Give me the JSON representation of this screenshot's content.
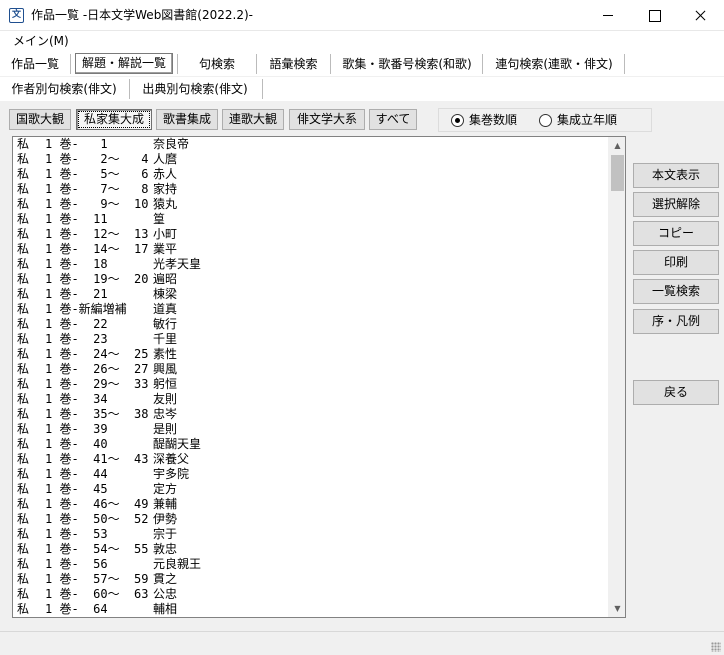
{
  "window": {
    "title": "作品一覧 -日本文学Web図書館(2022.2)-",
    "icon": "book-app-icon"
  },
  "menu": {
    "main": "メイン(M)"
  },
  "tabs_row1": [
    {
      "label": "作品一覧",
      "active": false
    },
    {
      "label": "解題・解説一覧",
      "active": true
    },
    {
      "label": "句検索",
      "active": false
    },
    {
      "label": "語彙検索",
      "active": false
    },
    {
      "label": "歌集・歌番号検索(和歌)",
      "active": false
    },
    {
      "label": "連句検索(連歌・俳文)",
      "active": false
    }
  ],
  "tabs_row2": [
    {
      "label": "作者別句検索(俳文)",
      "active": false
    },
    {
      "label": "出典別句検索(俳文)",
      "active": false
    }
  ],
  "category_buttons": [
    {
      "label": "国歌大観",
      "pressed": false
    },
    {
      "label": "私家集大成",
      "pressed": true
    },
    {
      "label": "歌書集成",
      "pressed": false
    },
    {
      "label": "連歌大観",
      "pressed": false
    },
    {
      "label": "俳文学大系",
      "pressed": false
    },
    {
      "label": "すべて",
      "pressed": false
    }
  ],
  "sort_options": [
    {
      "label": "集巻数順",
      "selected": true
    },
    {
      "label": "集成立年順",
      "selected": false
    }
  ],
  "list_rows": [
    [
      "私",
      "1 巻-   1",
      "奈良帝"
    ],
    [
      "私",
      "1 巻-   2～   4",
      "人麿"
    ],
    [
      "私",
      "1 巻-   5～   6",
      "赤人"
    ],
    [
      "私",
      "1 巻-   7～   8",
      "家持"
    ],
    [
      "私",
      "1 巻-   9～  10",
      "猿丸"
    ],
    [
      "私",
      "1 巻-  11",
      "篁"
    ],
    [
      "私",
      "1 巻-  12～  13",
      "小町"
    ],
    [
      "私",
      "1 巻-  14～  17",
      "業平"
    ],
    [
      "私",
      "1 巻-  18",
      "光孝天皇"
    ],
    [
      "私",
      "1 巻-  19～  20",
      "遍昭"
    ],
    [
      "私",
      "1 巻-  21",
      "棟梁"
    ],
    [
      "私",
      "1 巻-新編増補",
      "道真"
    ],
    [
      "私",
      "1 巻-  22",
      "敏行"
    ],
    [
      "私",
      "1 巻-  23",
      "千里"
    ],
    [
      "私",
      "1 巻-  24～  25",
      "素性"
    ],
    [
      "私",
      "1 巻-  26～  27",
      "興風"
    ],
    [
      "私",
      "1 巻-  29～  33",
      "躬恒"
    ],
    [
      "私",
      "1 巻-  34",
      "友則"
    ],
    [
      "私",
      "1 巻-  35～  38",
      "忠岑"
    ],
    [
      "私",
      "1 巻-  39",
      "是則"
    ],
    [
      "私",
      "1 巻-  40",
      "醍醐天皇"
    ],
    [
      "私",
      "1 巻-  41～  43",
      "深養父"
    ],
    [
      "私",
      "1 巻-  44",
      "宇多院"
    ],
    [
      "私",
      "1 巻-  45",
      "定方"
    ],
    [
      "私",
      "1 巻-  46～  49",
      "兼輔"
    ],
    [
      "私",
      "1 巻-  50～  52",
      "伊勢"
    ],
    [
      "私",
      "1 巻-  53",
      "宗于"
    ],
    [
      "私",
      "1 巻-  54～  55",
      "敦忠"
    ],
    [
      "私",
      "1 巻-  56",
      "元良親王"
    ],
    [
      "私",
      "1 巻-  57～  59",
      "貫之"
    ],
    [
      "私",
      "1 巻-  60～  63",
      "公忠"
    ],
    [
      "私",
      "1 巻-  64",
      "輔相"
    ]
  ],
  "side_buttons": {
    "show_text": "本文表示",
    "clear_selection": "選択解除",
    "copy": "コピー",
    "print": "印刷",
    "list_search": "一覧検索",
    "preface": "序・凡例",
    "back": "戻る"
  }
}
